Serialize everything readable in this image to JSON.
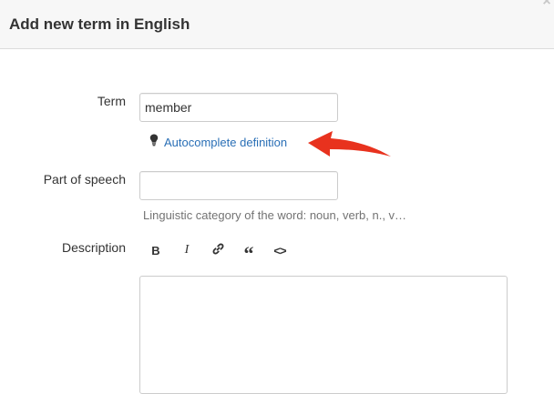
{
  "dialog": {
    "title": "Add new term in English",
    "close_icon": "close-icon"
  },
  "form": {
    "term": {
      "label": "Term",
      "value": "member"
    },
    "autocomplete": {
      "icon": "lightbulb-icon",
      "label": "Autocomplete definition"
    },
    "part_of_speech": {
      "label": "Part of speech",
      "value": "",
      "help": "Linguistic category of the word: noun, verb, n., v…"
    },
    "description": {
      "label": "Description",
      "toolbar": [
        {
          "name": "bold-button",
          "glyph": "B"
        },
        {
          "name": "italic-button",
          "glyph": "I"
        },
        {
          "name": "link-button",
          "glyph": ""
        },
        {
          "name": "quote-button",
          "glyph": "“"
        },
        {
          "name": "code-button",
          "glyph": "<>"
        }
      ],
      "value": ""
    }
  },
  "colors": {
    "link": "#2a6fb6",
    "annotation_arrow": "#e8321e",
    "header_bg": "#f7f7f7"
  }
}
